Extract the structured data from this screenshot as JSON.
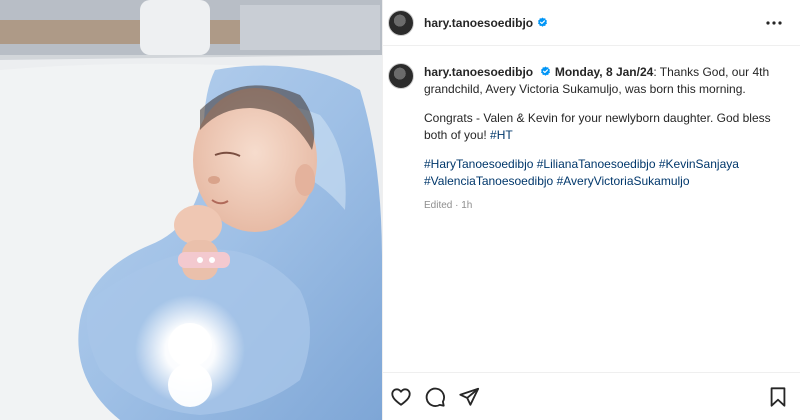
{
  "post": {
    "username": "hary.tanoesoedibjo",
    "verified": true,
    "caption": {
      "username": "hary.tanoesoedibjo",
      "date": "Monday, 8 Jan/24",
      "line1": ": Thanks God, our 4th grandchild, Avery Victoria Sukamuljo, was born this morning.",
      "line2": "Congrats - Valen & Kevin for your newlyborn daughter. God bless both of you! ",
      "sign_tag": "#HT",
      "hashtags": [
        "#HaryTanoesoedibjo",
        "#LilianaTanoesoedibjo",
        "#KevinSanjaya",
        "#ValenciaTanoesoedibjo",
        "#AveryVictoriaSukamuljo"
      ]
    },
    "meta": "Edited · 1h",
    "icons": {
      "more": "more-options-icon",
      "like": "heart-icon",
      "comment": "comment-icon",
      "share": "share-icon",
      "save": "bookmark-icon",
      "verified": "verified-badge-icon"
    },
    "colors": {
      "verified": "#0095f6",
      "hashtag": "#00376b",
      "text": "#262626",
      "muted": "#8e8e8e"
    }
  }
}
